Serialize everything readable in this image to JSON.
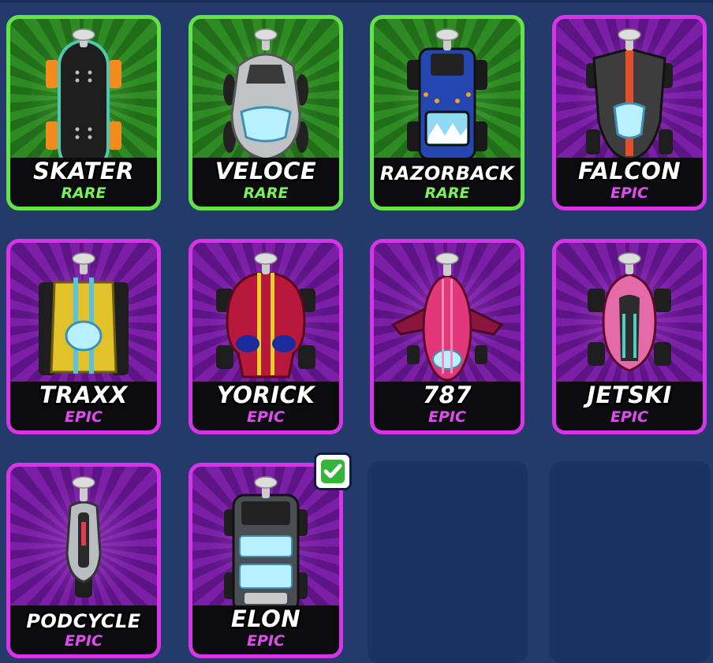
{
  "cars": [
    {
      "name": "SKATER",
      "rarity": "RARE",
      "rarity_color": "#63e24a"
    },
    {
      "name": "VELOCE",
      "rarity": "RARE",
      "rarity_color": "#63e24a"
    },
    {
      "name": "RAZORBACK",
      "rarity": "RARE",
      "rarity_color": "#63e24a"
    },
    {
      "name": "FALCON",
      "rarity": "EPIC",
      "rarity_color": "#d734e8"
    },
    {
      "name": "TRAXX",
      "rarity": "EPIC",
      "rarity_color": "#d734e8"
    },
    {
      "name": "YORICK",
      "rarity": "EPIC",
      "rarity_color": "#d734e8"
    },
    {
      "name": "787",
      "rarity": "EPIC",
      "rarity_color": "#d734e8"
    },
    {
      "name": "JETSKI",
      "rarity": "EPIC",
      "rarity_color": "#d734e8"
    },
    {
      "name": "PODCYCLE",
      "rarity": "EPIC",
      "rarity_color": "#d734e8"
    },
    {
      "name": "ELON",
      "rarity": "EPIC",
      "rarity_color": "#d734e8",
      "selected": true
    }
  ],
  "empty_slots": 2,
  "selected_icon": "checkmark-icon",
  "colors": {
    "background": "#233a6b",
    "empty_slot": "#1c3263",
    "rare": "#63e24a",
    "epic": "#d734e8",
    "check": "#34b53a"
  }
}
